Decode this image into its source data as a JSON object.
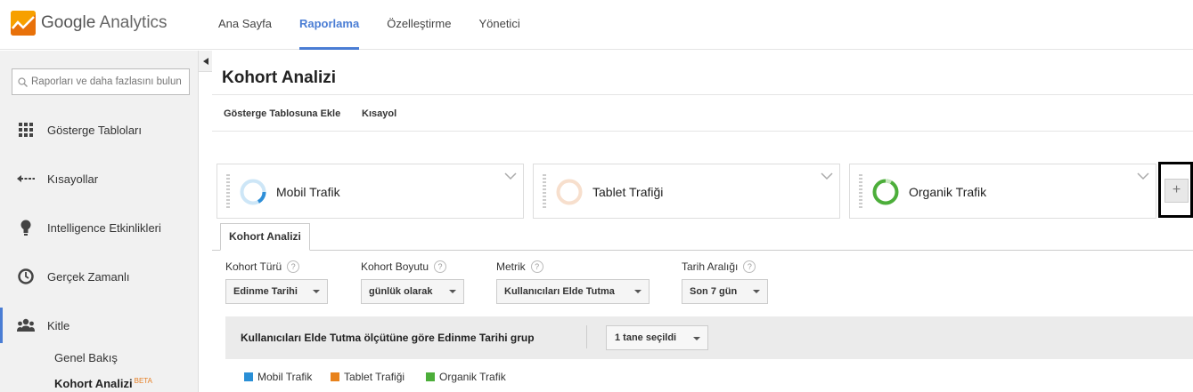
{
  "header": {
    "logo_google": "Google",
    "logo_product": "Analytics",
    "nav": [
      "Ana Sayfa",
      "Raporlama",
      "Özelleştirme",
      "Yönetici"
    ],
    "active_nav": "Raporlama"
  },
  "sidebar": {
    "search_placeholder": "Raporları ve daha fazlasını bulun",
    "items": [
      {
        "label": "Gösterge Tabloları",
        "icon": "grid-icon"
      },
      {
        "label": "Kısayollar",
        "icon": "shortcut-arrow-icon"
      },
      {
        "label": "Intelligence Etkinlikleri",
        "icon": "lightbulb-icon"
      },
      {
        "label": "Gerçek Zamanlı",
        "icon": "clock-icon"
      },
      {
        "label": "Kitle",
        "icon": "people-icon"
      }
    ],
    "sub_items": [
      "Genel Bakış",
      "Kohort Analizi"
    ],
    "beta_label": "BETA"
  },
  "page": {
    "title": "Kohort Analizi",
    "actions": [
      "Gösterge Tablosuna Ekle",
      "Kısayol"
    ]
  },
  "segments": [
    {
      "name": "Mobil Trafik",
      "color": "#2f8fd8",
      "ring_bg": "#cde6f7"
    },
    {
      "name": "Tablet Trafiği",
      "color": "#f7d9c4",
      "ring_bg": "#f7d9c4"
    },
    {
      "name": "Organik Trafik",
      "color": "#4cae3a",
      "ring_bg": "#4cae3a"
    }
  ],
  "add_segment": "+",
  "tab": "Kohort Analizi",
  "controls": [
    {
      "label": "Kohort Türü",
      "value": "Edinme Tarihi"
    },
    {
      "label": "Kohort Boyutu",
      "value": "günlük olarak"
    },
    {
      "label": "Metrik",
      "value": "Kullanıcıları Elde Tutma"
    },
    {
      "label": "Tarih Aralığı",
      "value": "Son 7 gün"
    }
  ],
  "help": "?",
  "group": {
    "title": "Kullanıcıları Elde Tutma ölçütüne göre Edinme Tarihi grup",
    "selector": "1 tane seçildi"
  },
  "legend": [
    {
      "name": "Mobil Trafik",
      "color": "#2a8fd6"
    },
    {
      "name": "Tablet Trafiği",
      "color": "#e8821c"
    },
    {
      "name": "Organik Trafik",
      "color": "#4cae3a"
    }
  ]
}
